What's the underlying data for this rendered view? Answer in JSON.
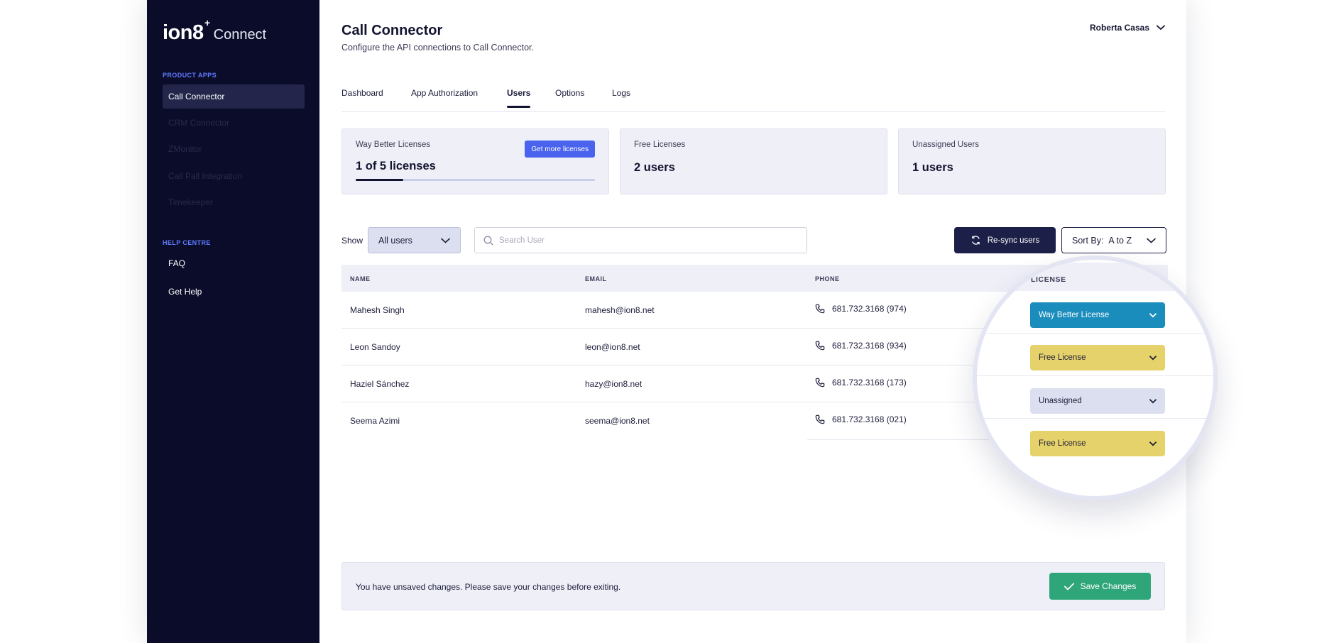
{
  "brand": {
    "logo": "ion8",
    "logo_sup": "+",
    "product": "Connect"
  },
  "sidebar": {
    "product_apps_label": "PRODUCT APPS",
    "apps": [
      {
        "label": "Call Connector",
        "active": true
      },
      {
        "label": "CRM Connector"
      },
      {
        "label": "ZMonitor"
      },
      {
        "label": "Call Pall Integration"
      },
      {
        "label": "Timekeeper"
      }
    ],
    "help_label": "HELP CENTRE",
    "help": [
      {
        "label": "FAQ"
      },
      {
        "label": "Get Help"
      }
    ]
  },
  "header": {
    "title": "Call Connector",
    "subtitle": "Configure the API connections to Call Connector.",
    "user_name": "Roberta Casas"
  },
  "tabs": [
    {
      "label": "Dashboard"
    },
    {
      "label": "App Authorization"
    },
    {
      "label": "Users",
      "active": true
    },
    {
      "label": "Options"
    },
    {
      "label": "Logs"
    }
  ],
  "cards": {
    "way_better": {
      "label": "Way Better Licenses",
      "value": "1 of 5 licenses",
      "button": "Get more licenses",
      "progress": 0.2
    },
    "free": {
      "label": "Free Licenses",
      "value": "2 users"
    },
    "unassigned": {
      "label": "Unassigned Users",
      "value": "1 users"
    }
  },
  "filters": {
    "show_label": "Show",
    "show_value": "All users",
    "search_placeholder": "Search User",
    "resync_label": "Re-sync users",
    "sort_label": "Sort By:",
    "sort_value": "A to Z"
  },
  "table": {
    "headers": {
      "name": "NAME",
      "email": "EMAIL",
      "phone": "PHONE",
      "license": "LICENSE"
    },
    "rows": [
      {
        "name": "Mahesh Singh",
        "email": "mahesh@ion8.net",
        "phone": "681.732.3168 (974)",
        "license": "Way Better License"
      },
      {
        "name": "Leon Sandoy",
        "email": "leon@ion8.net",
        "phone": "681.732.3168 (934)",
        "license": "Free License"
      },
      {
        "name": "Haziel Sánchez",
        "email": "hazy@ion8.net",
        "phone": "681.732.3168 (173)",
        "license": "Unassigned"
      },
      {
        "name": "Seema Azimi",
        "email": "seema@ion8.net",
        "phone": "681.732.3168 (021)",
        "license": "Free License"
      }
    ]
  },
  "footer": {
    "message": "You have unsaved changes. Please save your changes before exiting.",
    "save_label": "Save Changes"
  },
  "colors": {
    "sidebar_bg": "#0b0c2a",
    "accent": "#4a63ee",
    "way_better": "#1a8dbd",
    "free": "#e6d26a",
    "unassigned": "#dcdff0",
    "save": "#2fa57a"
  }
}
